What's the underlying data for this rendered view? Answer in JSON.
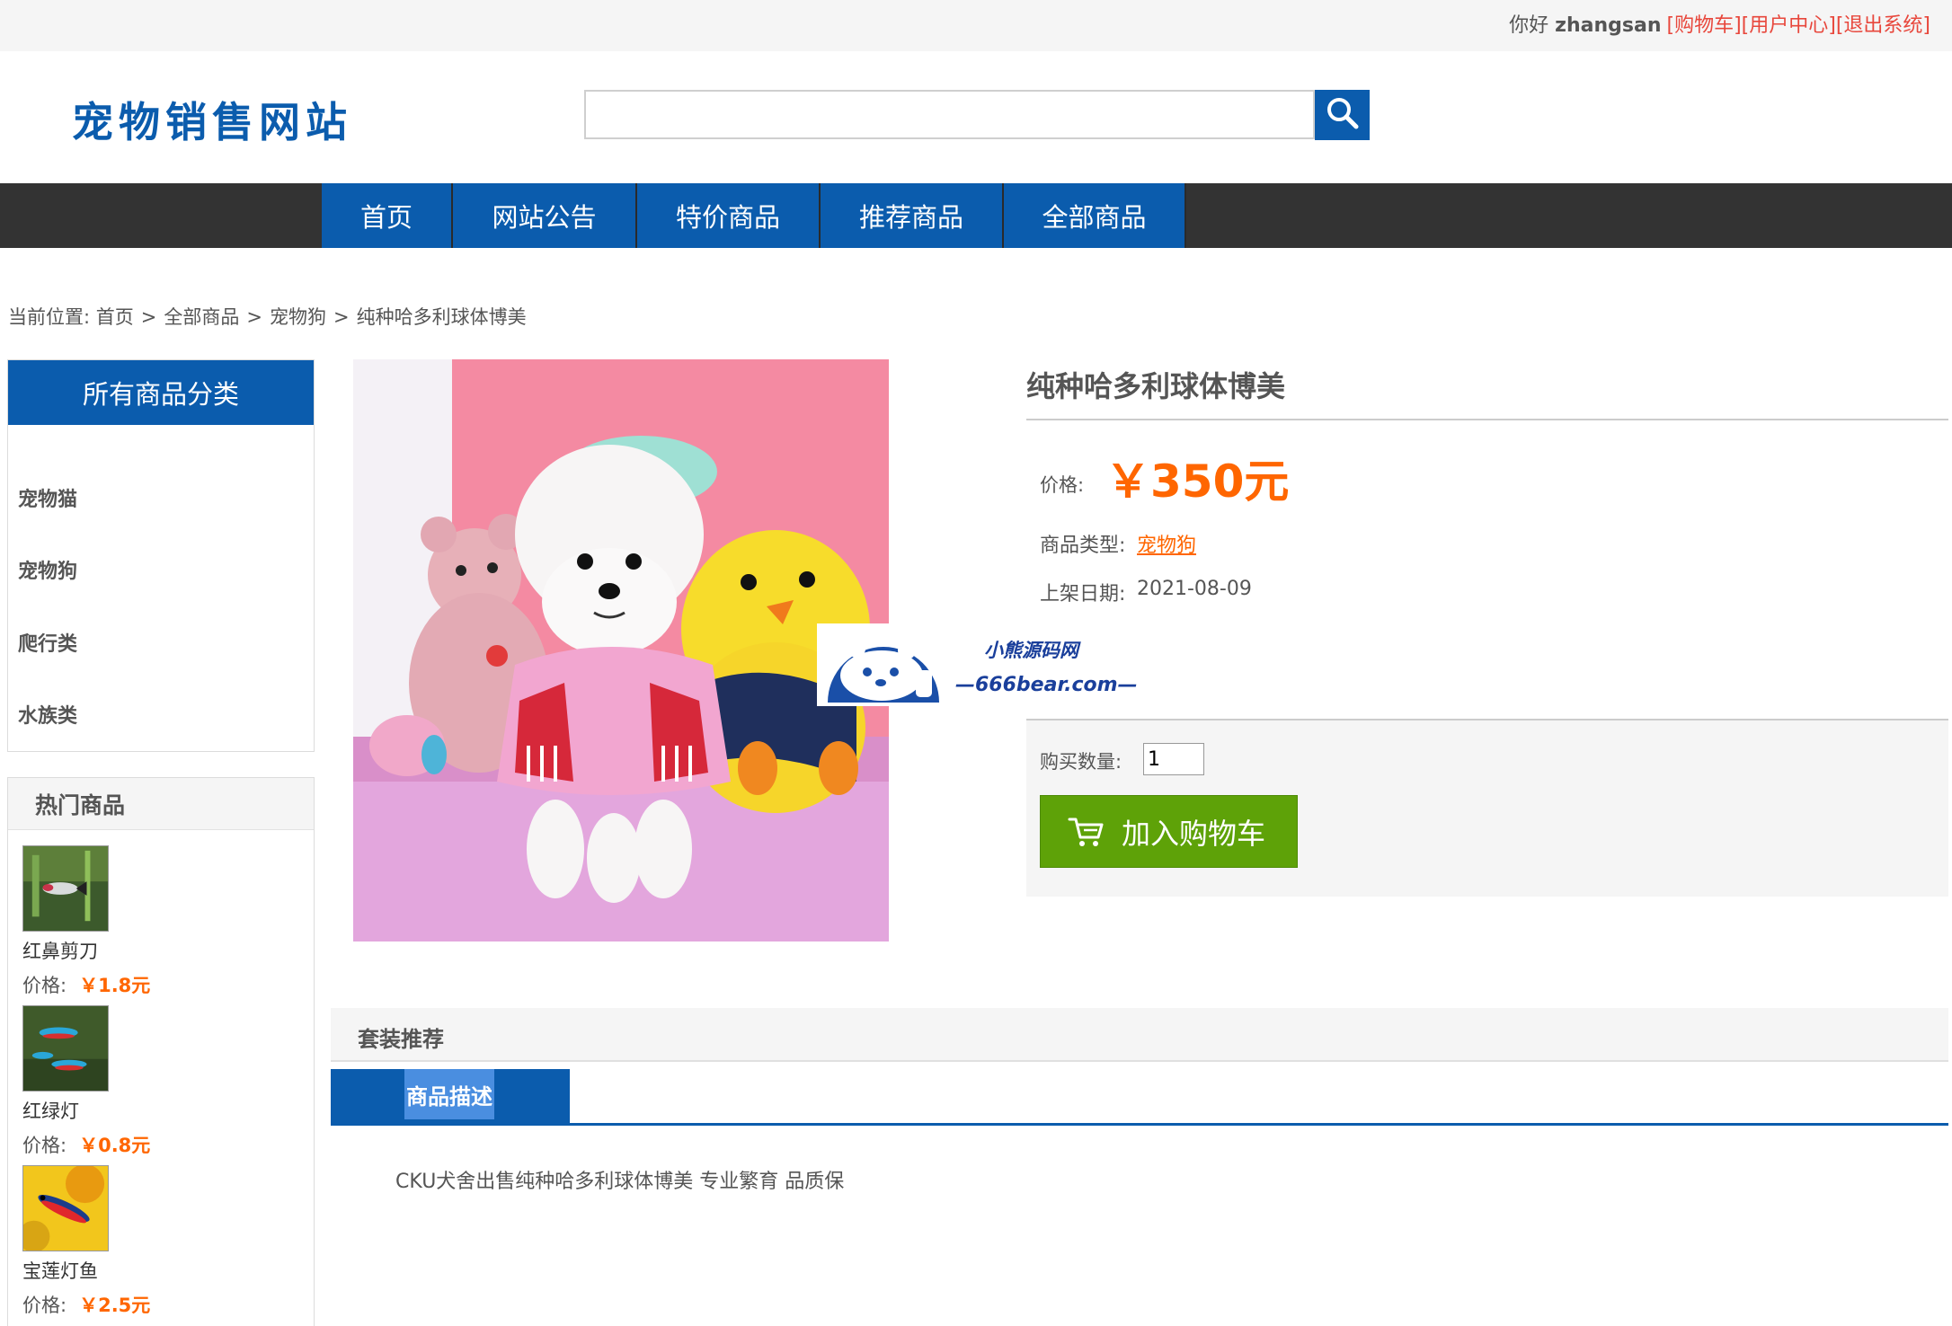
{
  "topbar": {
    "greeting": "你好",
    "username": "zhangsan",
    "cart_link": "[购物车]",
    "user_center_link": "[用户中心]",
    "logout_link": "[退出系统]"
  },
  "header": {
    "logo": "宠物销售网站",
    "search_placeholder": "",
    "search_icon": "search-icon"
  },
  "nav": {
    "items": [
      {
        "label": "首页"
      },
      {
        "label": "网站公告"
      },
      {
        "label": "特价商品"
      },
      {
        "label": "推荐商品"
      },
      {
        "label": "全部商品"
      }
    ]
  },
  "breadcrumb": {
    "prefix": "当前位置:",
    "items": [
      "首页",
      "全部商品",
      "宠物狗"
    ],
    "current": "纯种哈多利球体博美",
    "separator": ">"
  },
  "sidebar": {
    "category_title": "所有商品分类",
    "categories": [
      "宠物猫",
      "宠物狗",
      "爬行类",
      "水族类"
    ],
    "hot_title": "热门商品",
    "hot_items": [
      {
        "name": "红鼻剪刀",
        "price_label": "价格:",
        "price": "￥1.8元"
      },
      {
        "name": "红绿灯",
        "price_label": "价格:",
        "price": "￥0.8元"
      },
      {
        "name": "宝莲灯鱼",
        "price_label": "价格:",
        "price": "￥2.5元"
      }
    ]
  },
  "product": {
    "title": "纯种哈多利球体博美",
    "price_label": "价格:",
    "price": "￥350元",
    "type_label": "商品类型:",
    "type_value": "宠物狗",
    "date_label": "上架日期:",
    "date_value": "2021-08-09",
    "qty_label": "购买数量:",
    "qty_value": "1",
    "add_to_cart": "加入购物车"
  },
  "watermark": {
    "line1": "小熊源码网",
    "line2": "—666bear.com—"
  },
  "sections": {
    "package_title": "套装推荐",
    "desc_tab": "商品描述",
    "desc_text": "CKU犬舍出售纯种哈多利球体博美 专业繁育 品质保"
  },
  "colors": {
    "brand_blue": "#0b5cad",
    "price_orange": "#ff6600",
    "cart_green": "#5ea208",
    "link_red": "#e8473c",
    "nav_dark": "#333333"
  }
}
